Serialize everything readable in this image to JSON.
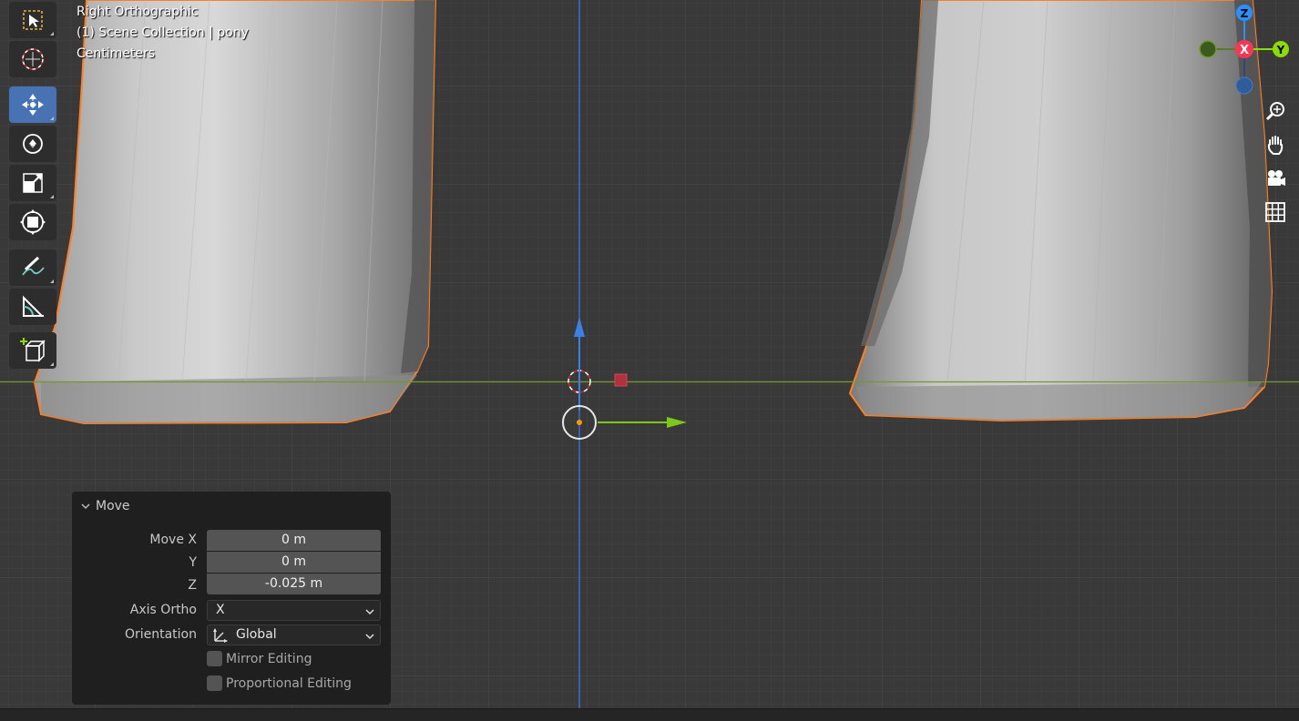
{
  "viewport": {
    "view_name": "Right Orthographic",
    "collection": "(1) Scene Collection | pony",
    "units": "Centimeters"
  },
  "toolbar": {
    "tools": [
      {
        "name": "select-box-tool",
        "icon": "select-box-icon",
        "active": false
      },
      {
        "name": "cursor-tool",
        "icon": "cursor-icon",
        "active": false
      },
      {
        "name": "move-tool",
        "icon": "move-icon",
        "active": true
      },
      {
        "name": "rotate-tool",
        "icon": "rotate-icon",
        "active": false
      },
      {
        "name": "scale-tool",
        "icon": "scale-icon",
        "active": false
      },
      {
        "name": "transform-tool",
        "icon": "transform-icon",
        "active": false
      },
      {
        "name": "annotate-tool",
        "icon": "annotate-icon",
        "active": false
      },
      {
        "name": "measure-tool",
        "icon": "measure-icon",
        "active": false
      },
      {
        "name": "add-cube-tool",
        "icon": "add-cube-icon",
        "active": false
      }
    ]
  },
  "gizmo": {
    "axes": [
      "Z",
      "X",
      "Y"
    ]
  },
  "nav_buttons": [
    "zoom-icon",
    "hand-pan-icon",
    "camera-icon",
    "grid-icon"
  ],
  "operator_panel": {
    "title": "Move",
    "move_x_label": "Move X",
    "move_x_value": "0 m",
    "y_label": "Y",
    "y_value": "0 m",
    "z_label": "Z",
    "z_value": "-0.025 m",
    "axis_ortho_label": "Axis Ortho",
    "axis_ortho_value": "X",
    "orientation_label": "Orientation",
    "orientation_value": "Global",
    "mirror_editing_label": "Mirror Editing",
    "proportional_editing_label": "Proportional Editing"
  },
  "colors": {
    "background": "#393939",
    "selection_outline": "#ff7f22",
    "axis_x": "#ff3352",
    "axis_y": "#8bdc00",
    "axis_z": "#2890ff",
    "active_tool": "#4772b3"
  }
}
